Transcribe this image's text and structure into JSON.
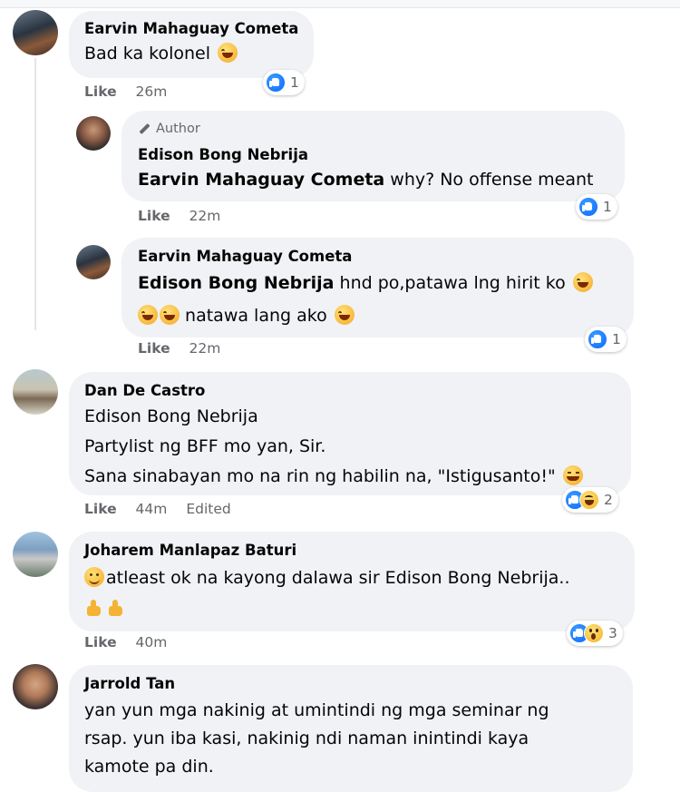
{
  "comments": [
    {
      "author": "Earvin Mahaguay Cometa",
      "text": "Bad ka kolonel",
      "like_label": "Like",
      "time": "26m",
      "reaction_count": "1",
      "replies": [
        {
          "badge": "Author",
          "author": "Edison Bong Nebrija",
          "mention": "Earvin Mahaguay Cometa",
          "text": " why? No offense meant",
          "like_label": "Like",
          "time": "22m",
          "reaction_count": "1"
        },
        {
          "author": "Earvin Mahaguay Cometa",
          "mention": "Edison Bong Nebrija",
          "text_line1": " hnd po,patawa lng hirit ko",
          "text_line2": " natawa lang ako",
          "like_label": "Like",
          "time": "22m",
          "reaction_count": "1"
        }
      ]
    },
    {
      "author": "Dan De Castro",
      "lines": [
        "Edison Bong Nebrija",
        "Partylist ng BFF mo yan, Sir.",
        "Sana sinabayan mo na rin ng habilin na, \"Istigusanto!\""
      ],
      "like_label": "Like",
      "time": "44m",
      "edited": "Edited",
      "reaction_count": "2"
    },
    {
      "author": "Joharem Manlapaz Baturi",
      "text": "atleast ok na kayong dalawa sir Edison Bong Nebrija..",
      "like_label": "Like",
      "time": "40m",
      "reaction_count": "3"
    },
    {
      "author": "Jarrold Tan",
      "lines": [
        "yan yun mga nakinig at umintindi ng mga seminar ng",
        "rsap. yun iba kasi, nakinig ndi naman inintindi kaya",
        "kamote pa din."
      ]
    }
  ],
  "icons": {
    "like": "like-reaction-icon",
    "haha": "haha-reaction-icon",
    "wow": "wow-reaction-icon"
  },
  "colors": {
    "bubble": "#f0f2f5",
    "meta": "#65676b",
    "like_blue": "#0866ff"
  }
}
